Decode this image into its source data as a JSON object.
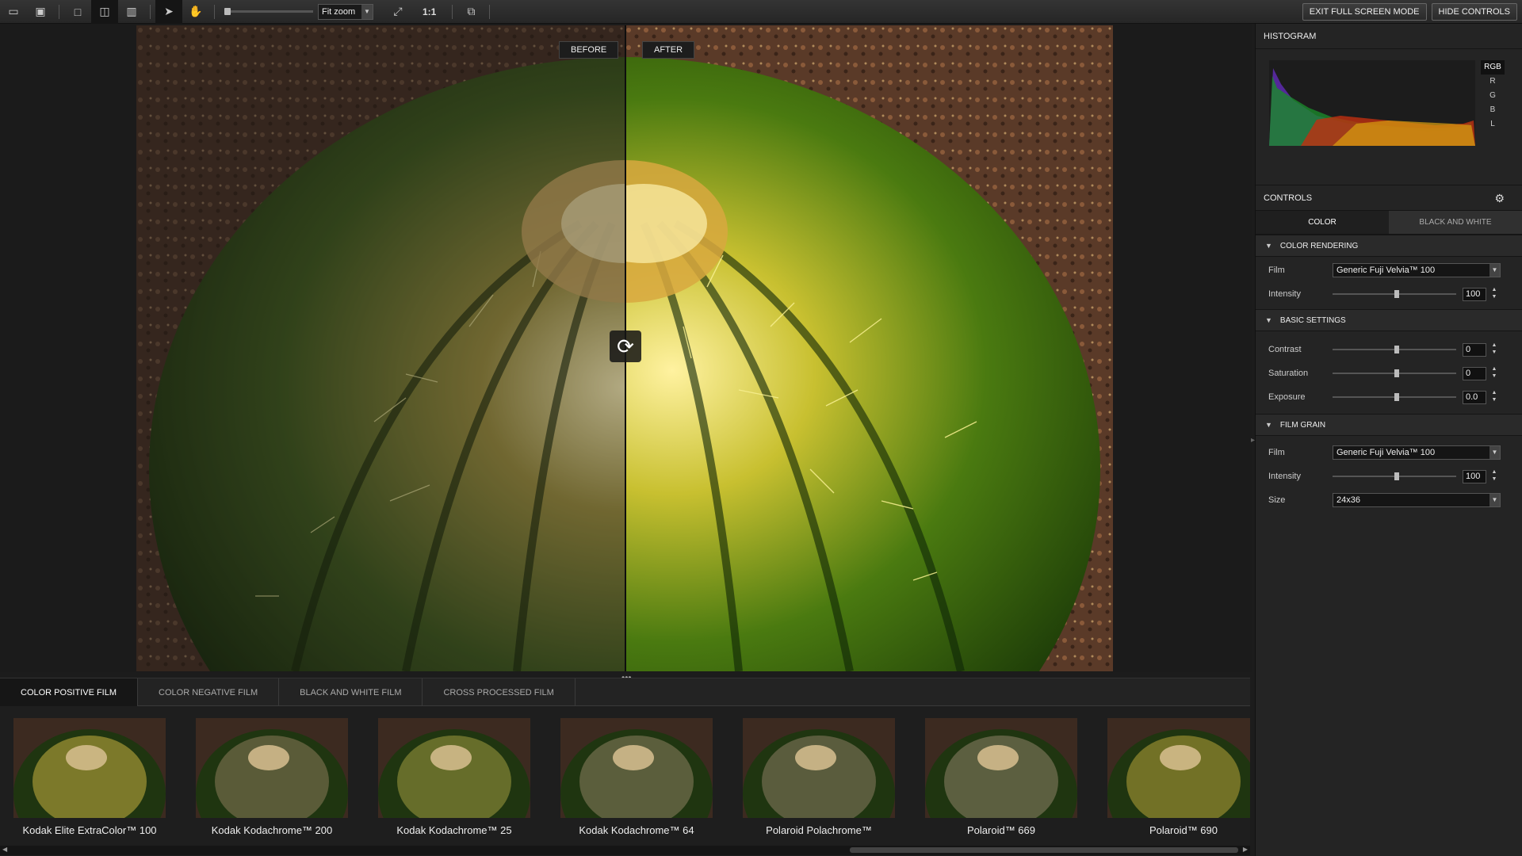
{
  "toolbar": {
    "icons": [
      "folder-icon",
      "save-icon",
      "single-view-icon",
      "split-view-icon",
      "side-by-side-icon",
      "pointer-icon",
      "hand-icon",
      "fit-screen-icon",
      "compare-window-icon"
    ],
    "zoom_value": "Fit zoom",
    "one_to_one": "1:1",
    "exit_full_screen": "EXIT FULL SCREEN MODE",
    "hide_controls": "HIDE CONTROLS"
  },
  "viewer": {
    "before_label": "BEFORE",
    "after_label": "AFTER"
  },
  "strip": {
    "tabs": [
      {
        "label": "COLOR POSITIVE FILM",
        "active": true
      },
      {
        "label": "COLOR NEGATIVE FILM",
        "active": false
      },
      {
        "label": "BLACK AND WHITE FILM",
        "active": false
      },
      {
        "label": "CROSS PROCESSED FILM",
        "active": false
      }
    ],
    "presets": [
      {
        "label": "Kodak Elite ExtraColor™ 100",
        "tone": "#c9b040"
      },
      {
        "label": "Kodak Kodachrome™ 200",
        "tone": "#8a7a5a"
      },
      {
        "label": "Kodak Kodachrome™ 25",
        "tone": "#a09a40"
      },
      {
        "label": "Kodak Kodachrome™ 64",
        "tone": "#8c8060"
      },
      {
        "label": "Polaroid Polachrome™",
        "tone": "#8a7c62"
      },
      {
        "label": "Polaroid™ 669",
        "tone": "#8e8268"
      },
      {
        "label": "Polaroid™ 690",
        "tone": "#b6a238"
      }
    ]
  },
  "panel": {
    "histogram_title": "HISTOGRAM",
    "channels": [
      "RGB",
      "R",
      "G",
      "B",
      "L"
    ],
    "controls_title": "CONTROLS",
    "tabs": [
      "COLOR",
      "BLACK AND WHITE"
    ],
    "color_rendering": {
      "title": "COLOR RENDERING",
      "film_label": "Film",
      "film_value": "Generic Fuji Velvia™ 100",
      "intensity_label": "Intensity",
      "intensity_value": "100"
    },
    "basic": {
      "title": "BASIC SETTINGS",
      "contrast_label": "Contrast",
      "contrast_value": "0",
      "saturation_label": "Saturation",
      "saturation_value": "0",
      "exposure_label": "Exposure",
      "exposure_value": "0.0"
    },
    "grain": {
      "title": "FILM GRAIN",
      "film_label": "Film",
      "film_value": "Generic Fuji Velvia™ 100",
      "intensity_label": "Intensity",
      "intensity_value": "100",
      "size_label": "Size",
      "size_value": "24x36"
    }
  }
}
